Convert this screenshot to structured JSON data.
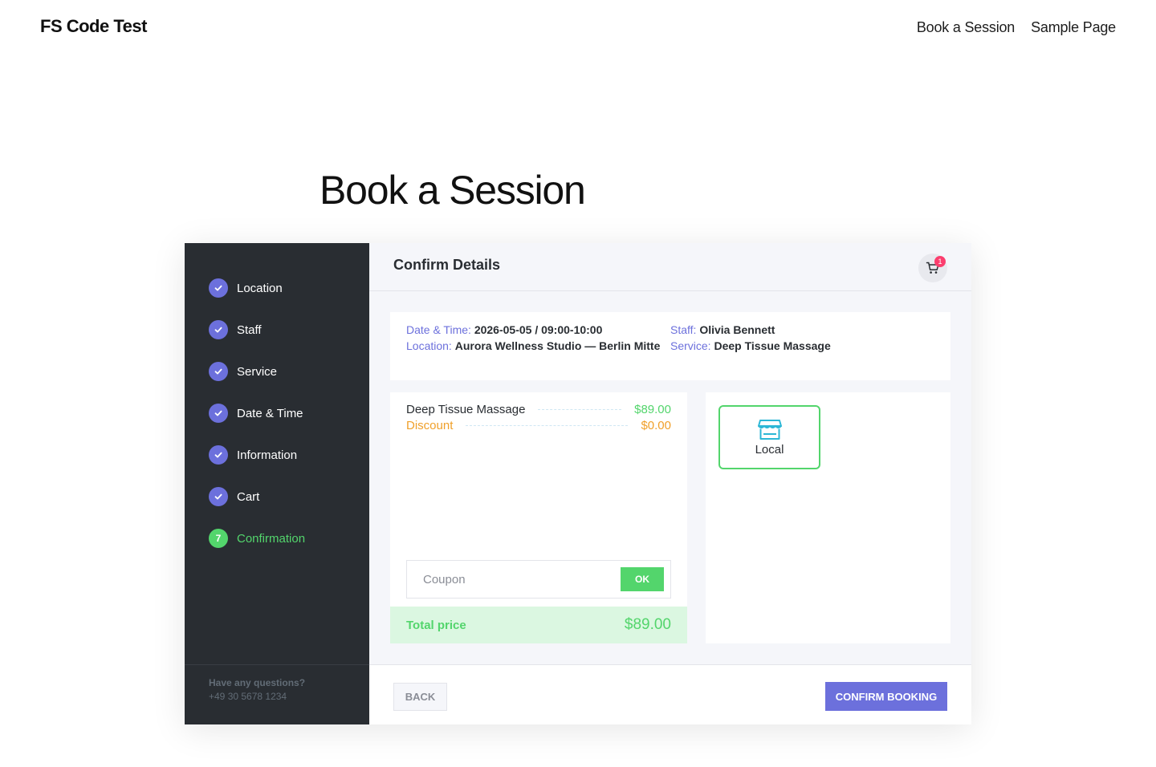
{
  "site": {
    "title": "FS Code Test",
    "nav": [
      "Book a Session",
      "Sample Page"
    ]
  },
  "page": {
    "title": "Book a Session"
  },
  "colors": {
    "accent": "#6c70dc",
    "success": "#53d56c",
    "warning": "#f0a02a",
    "sidebar": "#292d32",
    "badge": "#fb3e6e"
  },
  "steps": [
    {
      "label": "Location",
      "status": "done",
      "icon": "check-icon"
    },
    {
      "label": "Staff",
      "status": "done",
      "icon": "check-icon"
    },
    {
      "label": "Service",
      "status": "done",
      "icon": "check-icon"
    },
    {
      "label": "Date & Time",
      "status": "done",
      "icon": "check-icon"
    },
    {
      "label": "Information",
      "status": "done",
      "icon": "check-icon"
    },
    {
      "label": "Cart",
      "status": "done",
      "icon": "check-icon"
    },
    {
      "label": "Confirmation",
      "status": "current",
      "number": "7"
    }
  ],
  "help": {
    "title": "Have any questions?",
    "phone": "+49 30 5678 1234"
  },
  "content": {
    "title": "Confirm Details",
    "cart_count": "1",
    "cart_icon": "cart-icon"
  },
  "details": {
    "datetime_label": "Date & Time:",
    "datetime_value": "2026-05-05 / 09:00-10:00",
    "location_label": "Location:",
    "location_value": "Aurora Wellness Studio — Berlin Mitte",
    "staff_label": "Staff:",
    "staff_value": "Olivia Bennett",
    "service_label": "Service:",
    "service_value": "Deep Tissue Massage"
  },
  "pricing": {
    "service_name": "Deep Tissue Massage",
    "service_price": "$89.00",
    "discount_label": "Discount",
    "discount_value": "$0.00",
    "coupon_placeholder": "Coupon",
    "coupon_button": "OK",
    "total_label": "Total price",
    "total_value": "$89.00"
  },
  "payment": {
    "option_label": "Local",
    "option_icon": "store-icon"
  },
  "footer": {
    "back_label": "BACK",
    "confirm_label": "CONFIRM BOOKING"
  }
}
